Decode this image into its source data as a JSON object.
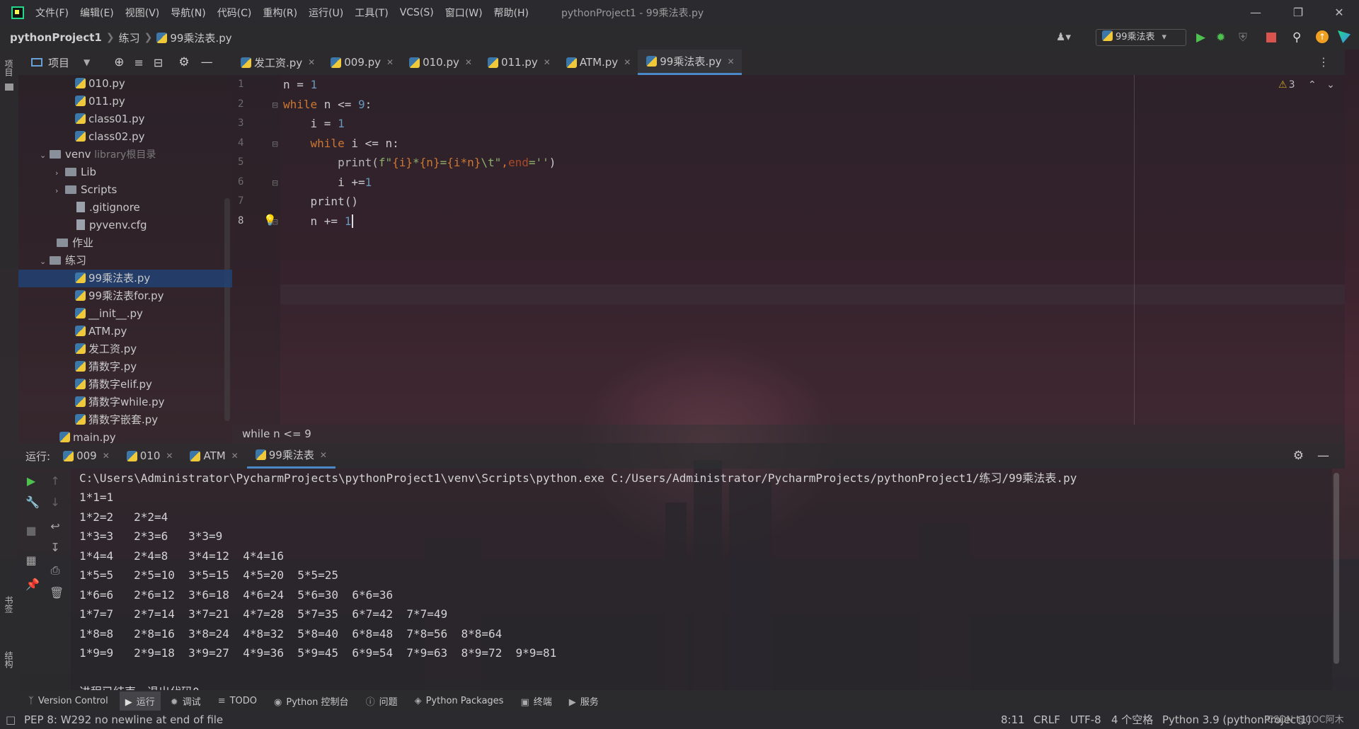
{
  "window": {
    "title": "pythonProject1 - 99乘法表.py",
    "menu": [
      "文件(F)",
      "编辑(E)",
      "视图(V)",
      "导航(N)",
      "代码(C)",
      "重构(R)",
      "运行(U)",
      "工具(T)",
      "VCS(S)",
      "窗口(W)",
      "帮助(H)"
    ]
  },
  "nav": {
    "project": "pythonProject1",
    "folder": "练习",
    "file": "99乘法表.py",
    "run_config": "99乘法表"
  },
  "left_stripe": {
    "top_label": "项目",
    "bottom_label1": "书签",
    "bottom_label2": "结构"
  },
  "project_panel": {
    "title": "项目",
    "tree": [
      {
        "label": "010.py",
        "type": "py",
        "depth": 3
      },
      {
        "label": "011.py",
        "type": "py",
        "depth": 3
      },
      {
        "label": "class01.py",
        "type": "py",
        "depth": 3
      },
      {
        "label": "class02.py",
        "type": "py",
        "depth": 3
      },
      {
        "label": "venv",
        "suffix": "library根目录",
        "type": "folder",
        "depth": 1,
        "expanded": true
      },
      {
        "label": "Lib",
        "type": "folder",
        "depth": 2,
        "expanded": false
      },
      {
        "label": "Scripts",
        "type": "folder",
        "depth": 2,
        "expanded": false
      },
      {
        "label": ".gitignore",
        "type": "file",
        "depth": 3
      },
      {
        "label": "pyvenv.cfg",
        "type": "file",
        "depth": 3
      },
      {
        "label": "作业",
        "type": "folder",
        "depth": 2
      },
      {
        "label": "练习",
        "type": "folder",
        "depth": 1,
        "expanded": true
      },
      {
        "label": "99乘法表.py",
        "type": "py",
        "depth": 3,
        "selected": true
      },
      {
        "label": "99乘法表for.py",
        "type": "py",
        "depth": 3
      },
      {
        "label": "__init__.py",
        "type": "py",
        "depth": 3
      },
      {
        "label": "ATM.py",
        "type": "py",
        "depth": 3
      },
      {
        "label": "发工资.py",
        "type": "py",
        "depth": 3
      },
      {
        "label": "猜数字.py",
        "type": "py",
        "depth": 3
      },
      {
        "label": "猜数字elif.py",
        "type": "py",
        "depth": 3
      },
      {
        "label": "猜数字while.py",
        "type": "py",
        "depth": 3
      },
      {
        "label": "猜数字嵌套.py",
        "type": "py",
        "depth": 3
      },
      {
        "label": "main.py",
        "type": "py",
        "depth": 2
      }
    ]
  },
  "editor": {
    "tabs": [
      {
        "label": "发工资.py",
        "active": false
      },
      {
        "label": "009.py",
        "active": false
      },
      {
        "label": "010.py",
        "active": false
      },
      {
        "label": "011.py",
        "active": false
      },
      {
        "label": "ATM.py",
        "active": false
      },
      {
        "label": "99乘法表.py",
        "active": true
      }
    ],
    "line_numbers": [
      "1",
      "2",
      "3",
      "4",
      "5",
      "6",
      "7",
      "8"
    ],
    "warning_count": "3",
    "breadcrumb": "while n <= 9",
    "code": {
      "l1_a": "n = ",
      "l1_b": "1",
      "l2_kw": "while",
      "l2_a": " n <= ",
      "l2_b": "9",
      "l2_c": ":",
      "l3_a": "    i = ",
      "l3_b": "1",
      "l4_kw": "    while",
      "l4_a": " i <= n:",
      "l5_a": "        print(",
      "l5_f": "f\"",
      "l5_s1": "{i}",
      "l5_s2": "*",
      "l5_s3": "{n}",
      "l5_s4": "=",
      "l5_s5": "{i*n}",
      "l5_s6": "\\t\"",
      "l5_comma": ",",
      "l5_param": "end",
      "l5_s7": "=''",
      "l5_end": ")",
      "l6_a": "        i +=",
      "l6_b": "1",
      "l7_a": "    print()",
      "l8_a": "    n += ",
      "l8_b": "1"
    }
  },
  "run_panel": {
    "label": "运行:",
    "tabs": [
      {
        "label": "009",
        "active": false
      },
      {
        "label": "010",
        "active": false
      },
      {
        "label": "ATM",
        "active": false
      },
      {
        "label": "99乘法表",
        "active": true
      }
    ],
    "console": [
      "C:\\Users\\Administrator\\PycharmProjects\\pythonProject1\\venv\\Scripts\\python.exe C:/Users/Administrator/PycharmProjects/pythonProject1/练习/99乘法表.py",
      "1*1=1",
      "1*2=2   2*2=4",
      "1*3=3   2*3=6   3*3=9",
      "1*4=4   2*4=8   3*4=12  4*4=16",
      "1*5=5   2*5=10  3*5=15  4*5=20  5*5=25",
      "1*6=6   2*6=12  3*6=18  4*6=24  5*6=30  6*6=36",
      "1*7=7   2*7=14  3*7=21  4*7=28  5*7=35  6*7=42  7*7=49",
      "1*8=8   2*8=16  3*8=24  4*8=32  5*8=40  6*8=48  7*8=56  8*8=64",
      "1*9=9   2*9=18  3*9=27  4*9=36  5*9=45  6*9=54  7*9=63  8*9=72  9*9=81",
      "",
      "进程已结束，退出代码0"
    ]
  },
  "bottom_tools": [
    {
      "label": "Version Control",
      "icon": "branch-icon"
    },
    {
      "label": "运行",
      "icon": "play-icon",
      "active": true
    },
    {
      "label": "调试",
      "icon": "bug-icon"
    },
    {
      "label": "TODO",
      "icon": "list-icon"
    },
    {
      "label": "Python 控制台",
      "icon": "python-icon"
    },
    {
      "label": "问题",
      "icon": "info-icon"
    },
    {
      "label": "Python Packages",
      "icon": "package-icon"
    },
    {
      "label": "终端",
      "icon": "terminal-icon"
    },
    {
      "label": "服务",
      "icon": "services-icon"
    }
  ],
  "status": {
    "message": "PEP 8: W292 no newline at end of file",
    "position": "8:11",
    "line_ending": "CRLF",
    "encoding": "UTF-8",
    "indent": "4 个空格",
    "interpreter": "Python 3.9 (pythonProject1)",
    "watermark": "CSDN @COC阿木"
  },
  "colors": {
    "accent": "#4a88c7",
    "keyword": "#cc7832",
    "number": "#6897bb",
    "string": "#8fae6b",
    "run_green": "#4fc14f",
    "stop_red": "#d9534f"
  }
}
